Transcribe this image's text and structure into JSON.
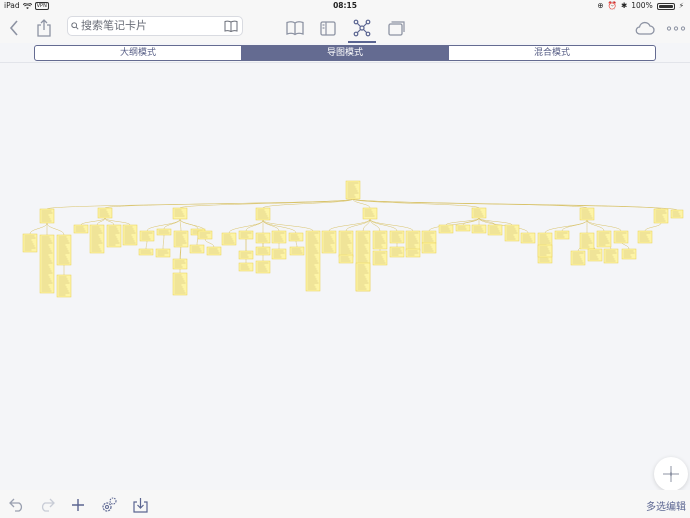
{
  "status_bar": {
    "device": "iPad",
    "vpn": "VPN",
    "time": "08:15",
    "battery": "100%"
  },
  "toolbar": {
    "search_placeholder": "搜索笔记卡片",
    "icons": [
      "back-icon",
      "share-icon",
      "book-icon",
      "outline-view-icon",
      "mindmap-view-icon",
      "card-view-icon",
      "cloud-sync-icon",
      "more-icon"
    ]
  },
  "mode_tabs": {
    "outline": "大纲模式",
    "mindmap": "导图模式",
    "mixed": "混合模式",
    "selected": "mindmap"
  },
  "bottom_bar": {
    "multi_select": "多选编辑",
    "icons": [
      "undo-icon",
      "redo-icon",
      "add-icon",
      "settings-icon",
      "import-icon"
    ]
  },
  "colors": {
    "accent": "#646b91",
    "card_fill": "#fdf4a6",
    "card_border": "#e8cf52",
    "link_line": "#d8c266",
    "background": "#f4f5f8"
  }
}
